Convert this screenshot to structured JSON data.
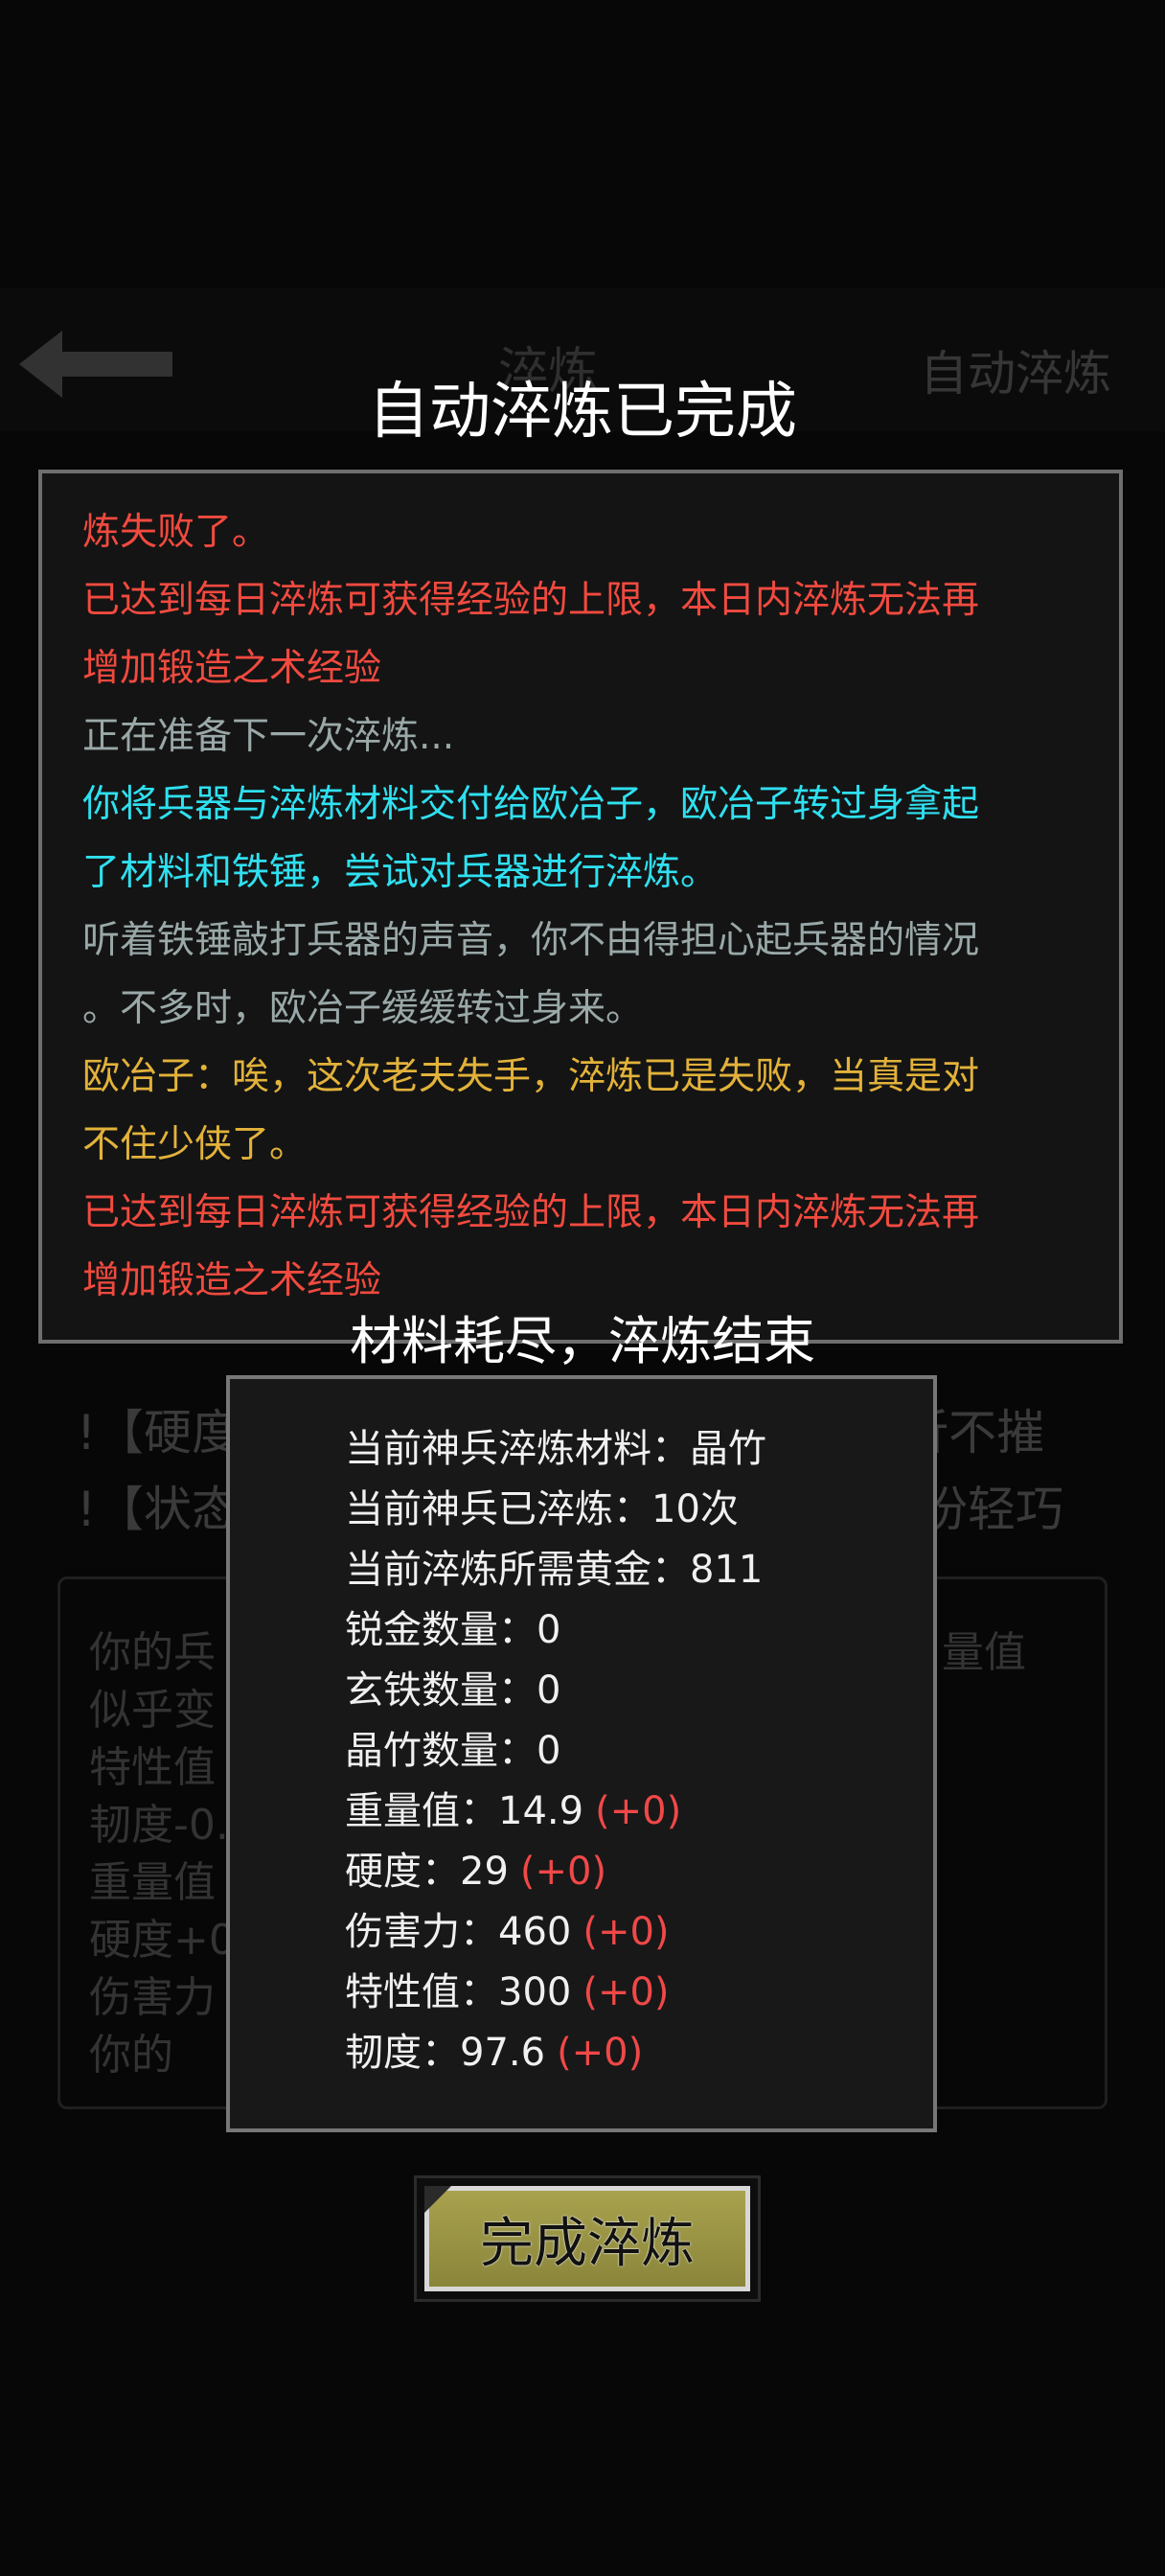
{
  "colors": {
    "red": "#f14a3f",
    "gray": "#9aa8a8",
    "cyan": "#2fe0f0",
    "gold": "#e2b23a",
    "white": "#ffffff",
    "delta_red": "#f04848",
    "button_bg": "#a39d4a"
  },
  "background": {
    "header_title": "淬炼",
    "header_right": "自动淬炼",
    "warn1_left": "!【硬度",
    "warn1_right": "百折不摧",
    "warn2_left": "!【状态",
    "warn2_right": "份轻巧",
    "panel_lines": [
      "你的兵",
      "似乎变",
      "特性值",
      "韧度-0.",
      "重量值",
      "硬度+0",
      "伤害力",
      "你的"
    ],
    "panel_right": "量值"
  },
  "modal": {
    "title": "自动淬炼已完成",
    "log": [
      {
        "text": "炼失败了。",
        "color": "#f14a3f"
      },
      {
        "text": "已达到每日淬炼可获得经验的上限，本日内淬炼无法再",
        "color": "#f14a3f"
      },
      {
        "text": "增加锻造之术经验",
        "color": "#f14a3f"
      },
      {
        "text": "正在准备下一次淬炼...",
        "color": "#9aa8a8"
      },
      {
        "text": "你将兵器与淬炼材料交付给欧冶子，欧冶子转过身拿起",
        "color": "#2fe0f0"
      },
      {
        "text": "了材料和铁锤，尝试对兵器进行淬炼。",
        "color": "#2fe0f0"
      },
      {
        "text": "听着铁锤敲打兵器的声音，你不由得担心起兵器的情况",
        "color": "#9aa8a8"
      },
      {
        "text": "。不多时，欧冶子缓缓转过身来。",
        "color": "#9aa8a8"
      },
      {
        "text": "欧冶子：唉，这次老夫失手，淬炼已是失败，当真是对",
        "color": "#e2b23a"
      },
      {
        "text": "不住少侠了。",
        "color": "#e2b23a"
      },
      {
        "text": "已达到每日淬炼可获得经验的上限，本日内淬炼无法再",
        "color": "#f14a3f"
      },
      {
        "text": "增加锻造之术经验",
        "color": "#f14a3f"
      }
    ],
    "summary_title": "材料耗尽，淬炼结束",
    "stats": [
      {
        "text": "当前神兵淬炼材料：晶竹",
        "delta": ""
      },
      {
        "text": "当前神兵已淬炼：10次",
        "delta": ""
      },
      {
        "text": "当前淬炼所需黄金：811",
        "delta": ""
      },
      {
        "text": "锐金数量：0",
        "delta": ""
      },
      {
        "text": "玄铁数量：0",
        "delta": ""
      },
      {
        "text": "晶竹数量：0",
        "delta": ""
      },
      {
        "text": "重量值：14.9",
        "delta": "(+0)"
      },
      {
        "text": "硬度：29",
        "delta": "(+0)"
      },
      {
        "text": "伤害力：460",
        "delta": "(+0)"
      },
      {
        "text": "特性值：300",
        "delta": "(+0)"
      },
      {
        "text": "韧度：97.6",
        "delta": "(+0)"
      }
    ],
    "finish_button": "完成淬炼"
  }
}
